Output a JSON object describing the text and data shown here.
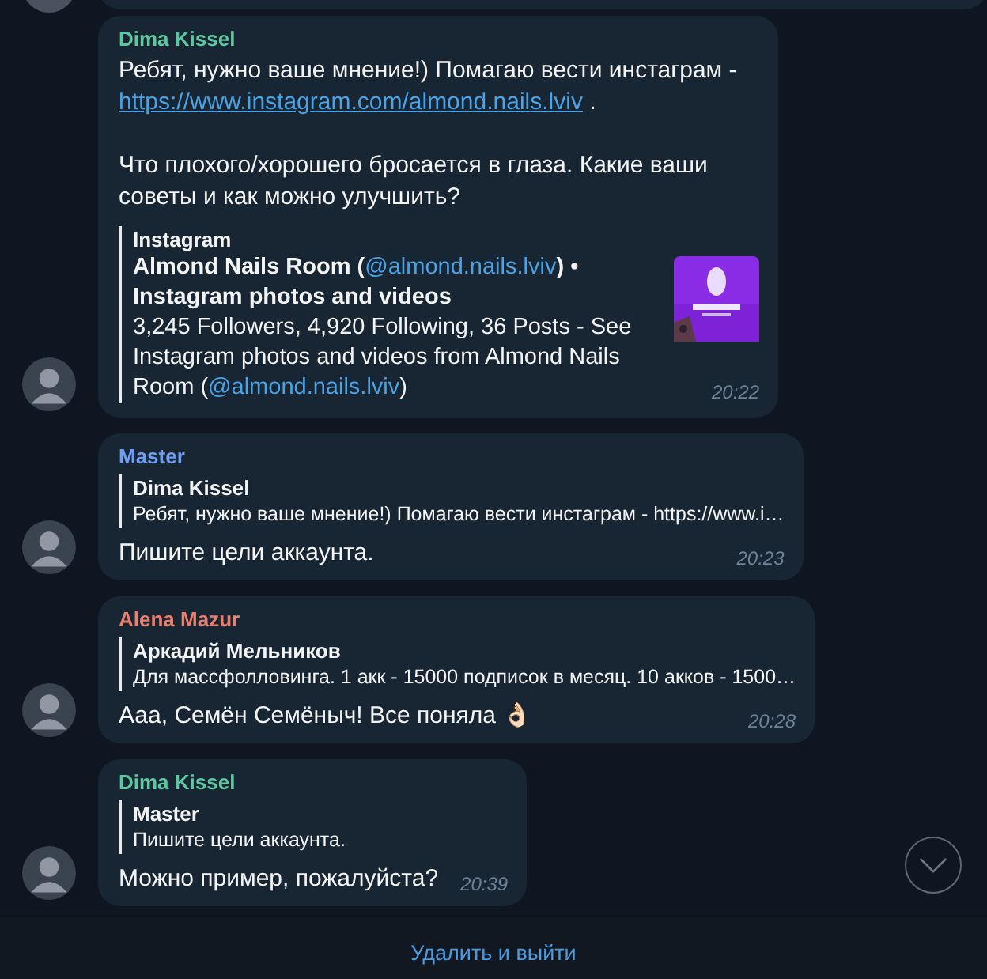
{
  "messages": [
    {
      "sender": "Dima Kissel",
      "color": "#5ec7a2",
      "text": [
        {
          "kind": "text",
          "text": "Ребят, нужно ваше мнение!) Помагаю вести инстаграм - "
        },
        {
          "kind": "link",
          "text": "https://www.instagram.com/almond.nails.lviv"
        },
        {
          "kind": "text",
          "text": " .\n\nЧто плохого/хорошего бросается в глаза. Какие ваши советы и как можно улучшить?"
        }
      ],
      "preview": {
        "site": "Instagram",
        "body": [
          {
            "kind": "bold",
            "text": "Almond Nails Room ("
          },
          {
            "kind": "mention",
            "text": "@almond.nails.lviv"
          },
          {
            "kind": "bold",
            "text": ") • Instagram photos and videos"
          },
          {
            "kind": "text",
            "text": "\n3,245 Followers, 4,920 Following, 36 Posts - See Instagram photos and videos from Almond Nails Room ("
          },
          {
            "kind": "mention",
            "text": "@almond.nails.lviv"
          },
          {
            "kind": "text",
            "text": ")"
          }
        ]
      },
      "time": "20:22"
    },
    {
      "sender": "Master",
      "color": "#6e9ff5",
      "reply": {
        "author": "Dima Kissel",
        "text": "Ребят, нужно ваше мнение!) Помагаю вести инстаграм - https://www.i…"
      },
      "text": [
        {
          "kind": "text",
          "text": "Пишите цели аккаунта."
        }
      ],
      "time": "20:23"
    },
    {
      "sender": "Alena Mazur",
      "color": "#e8806f",
      "reply": {
        "author": "Аркадий Мельников",
        "text": "Для массфолловинга. 1 акк - 15000 подписок в месяц. 10 акков - 1500…"
      },
      "text": [
        {
          "kind": "text",
          "text": "Ааа, Семён Семёныч! Все поняла 👌🏻"
        }
      ],
      "time": "20:28"
    },
    {
      "sender": "Dima Kissel",
      "color": "#5ec7a2",
      "reply": {
        "author": "Master",
        "text": "Пишите цели аккаунта."
      },
      "text": [
        {
          "kind": "text",
          "text": "Можно пример, пожалуйста?"
        }
      ],
      "time": "20:39"
    }
  ],
  "footer": {
    "action": "Удалить и выйти"
  }
}
